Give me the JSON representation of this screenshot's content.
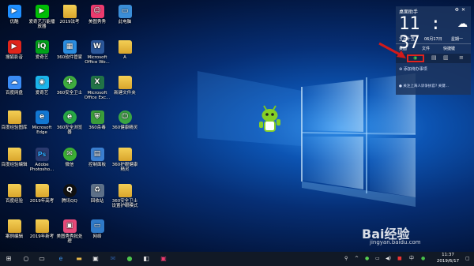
{
  "desktop_icons": [
    {
      "label": "优酷",
      "icon": "youku-icon",
      "color": "#1f8fff",
      "glyph": "▶"
    },
    {
      "label": "搜狐影音",
      "icon": "sohu-video-icon",
      "color": "#e0251b",
      "glyph": "▶"
    },
    {
      "label": "百度网盘",
      "icon": "baidu-netdisk-icon",
      "color": "#3a8bf3",
      "glyph": "☁"
    },
    {
      "label": "百度经验图库",
      "icon": "folder-icon",
      "color": "#e8b84a",
      "glyph": ""
    },
    {
      "label": "百度经验编辑",
      "icon": "folder-icon",
      "color": "#e8b84a",
      "glyph": ""
    },
    {
      "label": "百度经验",
      "icon": "folder-icon",
      "color": "#e8b84a",
      "glyph": ""
    },
    {
      "label": "案例编辑",
      "icon": "folder-icon",
      "color": "#e8b84a",
      "glyph": ""
    },
    {
      "label": "爱奇艺万能播放器",
      "icon": "iqiyi-player-icon",
      "color": "#00be06",
      "glyph": "▶"
    },
    {
      "label": "爱奇艺",
      "icon": "iqiyi-icon",
      "color": "#00a11a",
      "glyph": "iQ"
    },
    {
      "label": "爱奇艺",
      "icon": "iqiyi-app-icon",
      "color": "#1cb4ea",
      "glyph": "◉"
    },
    {
      "label": "Microsoft Edge",
      "icon": "edge-icon",
      "color": "#1277d2",
      "glyph": "e"
    },
    {
      "label": "Adobe Photosho...",
      "icon": "photoshop-icon",
      "color": "#2a3a6f",
      "glyph": "Ps"
    },
    {
      "label": "2019年高考",
      "icon": "folder-icon",
      "color": "#e8b84a",
      "glyph": ""
    },
    {
      "label": "2019年新考",
      "icon": "folder-icon",
      "color": "#e8b84a",
      "glyph": ""
    },
    {
      "label": "2019法考",
      "icon": "folder-icon",
      "color": "#e8b84a",
      "glyph": ""
    },
    {
      "label": "360软件管家",
      "icon": "360-software-icon",
      "color": "#2b8de0",
      "glyph": "▦"
    },
    {
      "label": "360安全卫士",
      "icon": "360-security-icon",
      "color": "#3eac3e",
      "glyph": "✚"
    },
    {
      "label": "360安全浏览器",
      "icon": "360-browser-icon",
      "color": "#28a745",
      "glyph": "e"
    },
    {
      "label": "微信",
      "icon": "wechat-icon",
      "color": "#3cb034",
      "glyph": "✉"
    },
    {
      "label": "腾讯QQ",
      "icon": "qq-icon",
      "color": "#111111",
      "glyph": "Q"
    },
    {
      "label": "美图秀秀批处理",
      "icon": "meitu-batch-icon",
      "color": "#e84a7a",
      "glyph": "▣"
    },
    {
      "label": "美图秀秀",
      "icon": "meitu-icon",
      "color": "#ec3b6e",
      "glyph": "☺"
    },
    {
      "label": "Microsoft Office Wo...",
      "icon": "word-icon",
      "color": "#2b579a",
      "glyph": "W"
    },
    {
      "label": "Microsoft Office Exc...",
      "icon": "excel-icon",
      "color": "#217346",
      "glyph": "X"
    },
    {
      "label": "360杀毒",
      "icon": "360-antivirus-icon",
      "color": "#3a9d3a",
      "glyph": "⛨"
    },
    {
      "label": "控制面板",
      "icon": "control-panel-icon",
      "color": "#3b7fd0",
      "glyph": "▤"
    },
    {
      "label": "回收站",
      "icon": "recycle-bin-icon",
      "color": "#5d7088",
      "glyph": "♻"
    },
    {
      "label": "网络",
      "icon": "network-icon",
      "color": "#2f7ac9",
      "glyph": "▭"
    },
    {
      "label": "此电脑",
      "icon": "this-pc-icon",
      "color": "#3b8ed8",
      "glyph": "▭"
    },
    {
      "label": "A",
      "icon": "folder-icon",
      "color": "#e8b84a",
      "glyph": ""
    },
    {
      "label": "新建文件夹",
      "icon": "folder-icon",
      "color": "#e8b84a",
      "glyph": ""
    },
    {
      "label": "360健康精灵",
      "icon": "360-health-icon",
      "color": "#3aa543",
      "glyph": "☺"
    },
    {
      "label": "360护眼健康精灵",
      "icon": "folder-icon",
      "color": "#e8b84a",
      "glyph": ""
    },
    {
      "label": "360安全卫士设置护眼模式",
      "icon": "folder-icon",
      "color": "#e8b84a",
      "glyph": ""
    }
  ],
  "widget": {
    "title": "桌面助手",
    "time": "11 : 37",
    "weekday": "五月十五",
    "date": "06月17日",
    "day": "星期一",
    "tabs": [
      "桌面",
      "文件",
      "快捷键"
    ],
    "add_todo": "添加待办事项",
    "news": "关注上海人诉争执官? 关键..."
  },
  "taskbar": {
    "time": "11:37",
    "date": "2019/6/17",
    "lang": "中"
  },
  "watermark": {
    "brand": "Bai经验",
    "url": "jingyan.baidu.com"
  }
}
